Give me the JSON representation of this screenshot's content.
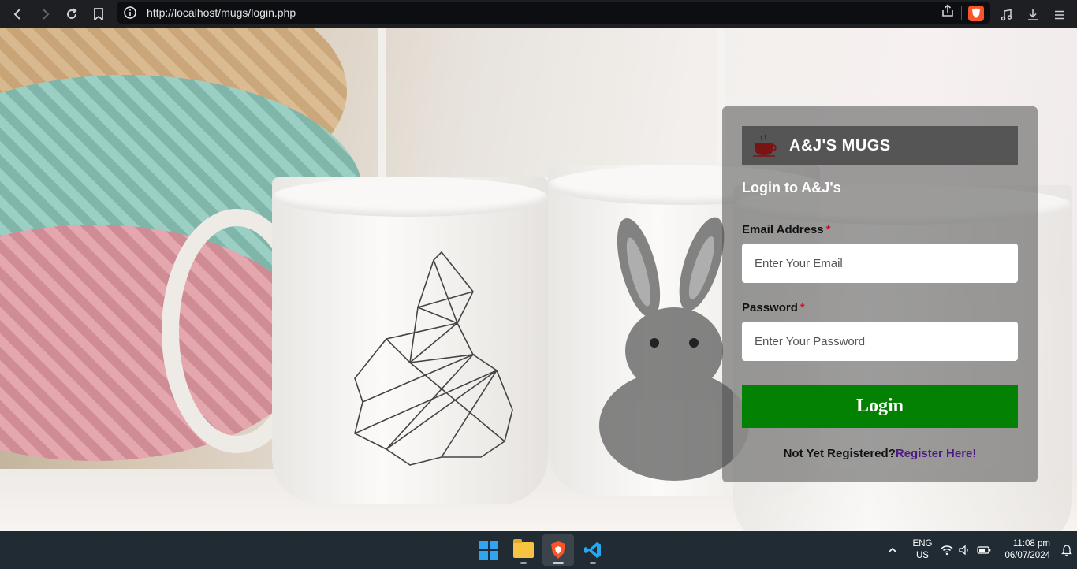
{
  "browser": {
    "url": "http://localhost/mugs/login.php",
    "icons": [
      "back-arrow-icon",
      "forward-arrow-icon",
      "reload-icon",
      "bookmark-icon",
      "site-info-icon",
      "share-icon",
      "brave-shield-icon",
      "music-icon",
      "download-icon",
      "menu-icon"
    ]
  },
  "login": {
    "brand_name": "A&J'S MUGS",
    "heading": "Login to A&J's",
    "email_label": "Email Address",
    "email_placeholder": "Enter Your Email",
    "email_value": "",
    "password_label": "Password",
    "password_placeholder": "Enter Your Password",
    "password_value": "",
    "required_marker": "*",
    "submit_label": "Login",
    "register_prompt": "Not Yet Registered?",
    "register_link": "Register Here!"
  },
  "taskbar": {
    "apps": [
      "windows-start",
      "file-explorer",
      "brave-browser",
      "vs-code"
    ],
    "language_top": "ENG",
    "language_bottom": "US",
    "time": "11:08 pm",
    "date": "06/07/2024"
  },
  "colors": {
    "login_button": "#028102",
    "register_link": "#4b1b86",
    "required": "#c8102e"
  }
}
